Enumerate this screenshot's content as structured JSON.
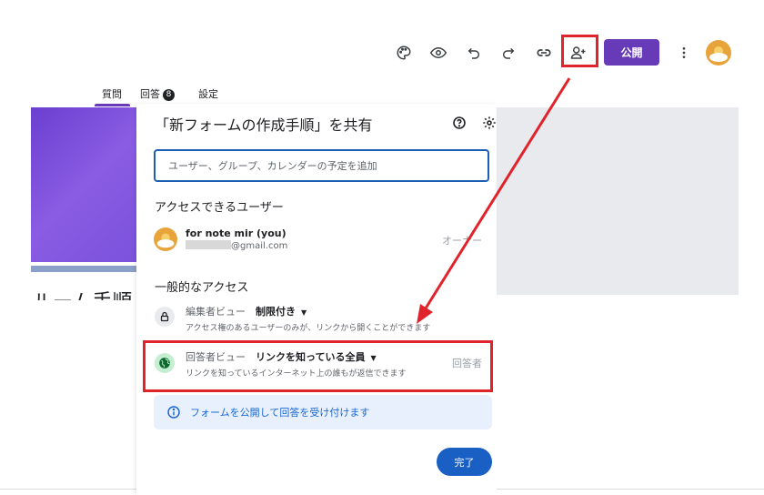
{
  "toolbar": {
    "icons": [
      "palette-icon",
      "eye-icon",
      "undo-icon",
      "redo-icon",
      "link-icon",
      "add-person-icon",
      "more-vert-icon"
    ],
    "publish_label": "公開"
  },
  "tabs": {
    "questions": "質問",
    "responses": "回答",
    "responses_count": "8",
    "settings": "設定"
  },
  "background": {
    "partial_title": "ルーム手順"
  },
  "dialog": {
    "title": "「新フォームの作成手順」を共有",
    "search_placeholder": "ユーザー、グループ、カレンダーの予定を追加",
    "access_users_heading": "アクセスできるユーザー",
    "user": {
      "name": "for note mir (you)",
      "email_suffix": "@gmail.com",
      "role": "オーナー"
    },
    "general_access_heading": "一般的なアクセス",
    "editor_row": {
      "label": "編集者ビュー",
      "value": "制限付き",
      "description": "アクセス権のあるユーザーのみが、リンクから開くことができます"
    },
    "responder_row": {
      "label": "回答者ビュー",
      "value": "リンクを知っている全員",
      "description": "リンクを知っているインターネット上の誰もが返信できます",
      "role": "回答者"
    },
    "info_text": "フォームを公開して回答を受け付けます",
    "done_label": "完了"
  },
  "colors": {
    "accent_purple": "#673ab7",
    "primary_blue": "#1a5fc4",
    "annotation_red": "#e0242b"
  }
}
